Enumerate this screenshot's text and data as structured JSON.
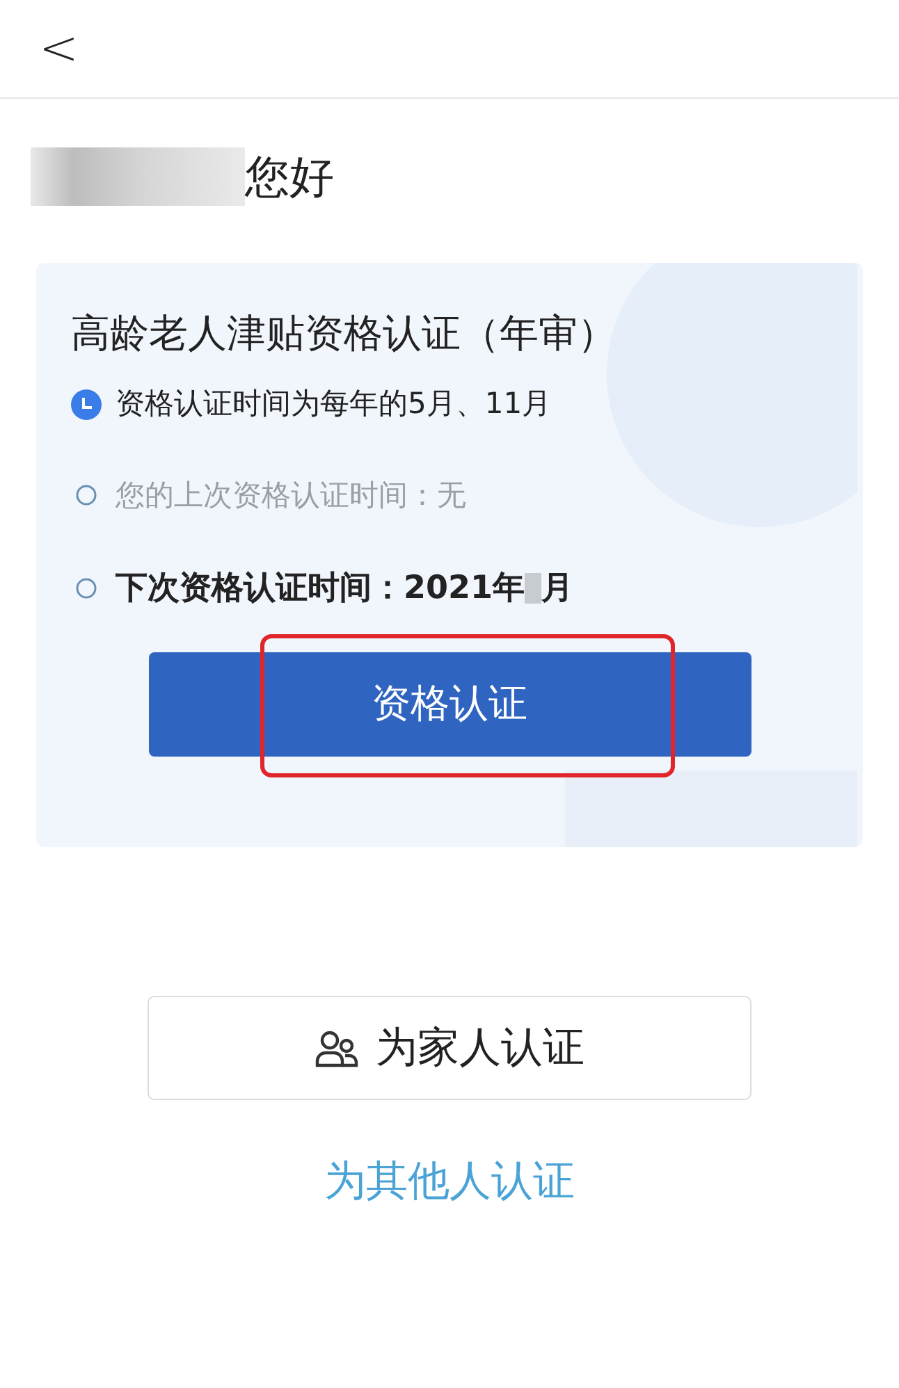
{
  "header": {
    "back": "<"
  },
  "greeting": {
    "name_redacted": true,
    "text": "您好"
  },
  "card": {
    "title": "高龄老人津贴资格认证（年审）",
    "rows": [
      {
        "kind": "clock",
        "text": "资格认证时间为每年的5月、11月"
      },
      {
        "kind": "muted",
        "text": "您的上次资格认证时间：无"
      },
      {
        "kind": "emphasis",
        "text": "下次资格认证时间：",
        "value": "2021年",
        "redacted": true,
        "value_after": "月"
      }
    ],
    "button": {
      "label": "资格认证",
      "highlighted": true
    }
  },
  "family_button": {
    "label": "为家人认证"
  },
  "others_link": "为其他人认证"
}
